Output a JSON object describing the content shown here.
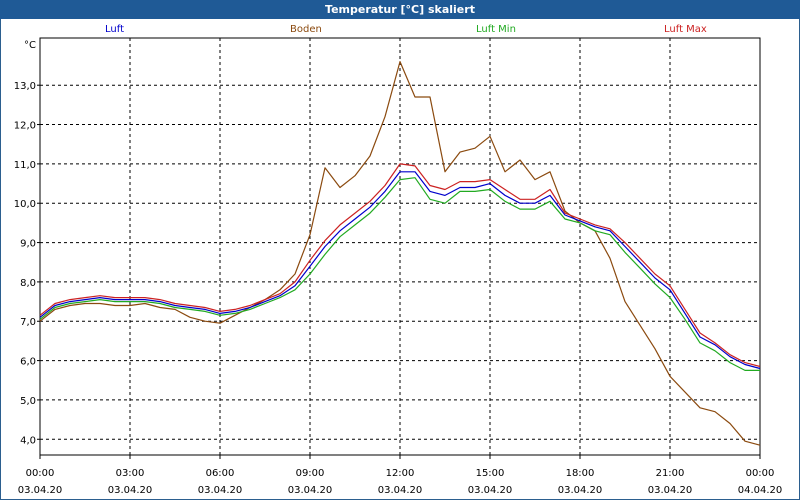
{
  "chart_data": {
    "type": "line",
    "title": "Temperatur [°C] skaliert",
    "y_unit": "°C",
    "ylim": [
      3.6,
      14.2
    ],
    "yticks": [
      "13,0",
      "12,0",
      "11,0",
      "10,0",
      "9,0",
      "8,0",
      "7,0",
      "6,0",
      "5,0",
      "4,0"
    ],
    "ytick_values": [
      13,
      12,
      11,
      10,
      9,
      8,
      7,
      6,
      5,
      4
    ],
    "x_ticks": [
      {
        "time": "00:00",
        "date": "03.04.20"
      },
      {
        "time": "03:00",
        "date": "03.04.20"
      },
      {
        "time": "06:00",
        "date": "03.04.20"
      },
      {
        "time": "09:00",
        "date": "03.04.20"
      },
      {
        "time": "12:00",
        "date": "03.04.20"
      },
      {
        "time": "15:00",
        "date": "03.04.20"
      },
      {
        "time": "18:00",
        "date": "03.04.20"
      },
      {
        "time": "21:00",
        "date": "03.04.20"
      },
      {
        "time": "00:00",
        "date": "04.04.20"
      }
    ],
    "x_hours_range": [
      0,
      24
    ],
    "grid": true,
    "legend_position": "top",
    "series": [
      {
        "name": "Luft",
        "color": "#0000cc",
        "x": [
          0,
          0.5,
          1,
          1.5,
          2,
          2.5,
          3,
          3.5,
          4,
          4.5,
          5,
          5.5,
          6,
          6.5,
          7,
          7.5,
          8,
          8.5,
          9,
          9.5,
          10,
          10.5,
          11,
          11.5,
          12,
          12.5,
          13,
          13.5,
          14,
          14.5,
          15,
          15.5,
          16,
          16.5,
          17,
          17.5,
          18,
          18.5,
          19,
          19.5,
          20,
          20.5,
          21,
          21.5,
          22,
          22.5,
          23,
          23.5,
          24
        ],
        "values": [
          7.1,
          7.4,
          7.5,
          7.55,
          7.6,
          7.55,
          7.55,
          7.55,
          7.5,
          7.4,
          7.35,
          7.3,
          7.2,
          7.25,
          7.35,
          7.5,
          7.65,
          7.9,
          8.4,
          8.9,
          9.3,
          9.6,
          9.9,
          10.3,
          10.8,
          10.8,
          10.3,
          10.2,
          10.4,
          10.4,
          10.5,
          10.2,
          10.0,
          10.0,
          10.2,
          9.7,
          9.55,
          9.4,
          9.3,
          8.9,
          8.5,
          8.1,
          7.8,
          7.2,
          6.6,
          6.4,
          6.1,
          5.9,
          5.8
        ]
      },
      {
        "name": "Boden",
        "color": "#8b4a0f",
        "x": [
          0,
          0.5,
          1,
          1.5,
          2,
          2.5,
          3,
          3.5,
          4,
          4.5,
          5,
          5.5,
          6,
          6.5,
          7,
          7.5,
          8,
          8.5,
          9,
          9.5,
          10,
          10.5,
          11,
          11.5,
          12,
          12.5,
          13,
          13.5,
          14,
          14.5,
          15,
          15.5,
          16,
          16.5,
          17,
          17.5,
          18,
          18.5,
          19,
          19.5,
          20,
          20.5,
          21,
          21.5,
          22,
          22.5,
          23,
          23.5,
          24
        ],
        "values": [
          7.0,
          7.3,
          7.4,
          7.45,
          7.45,
          7.4,
          7.4,
          7.45,
          7.35,
          7.3,
          7.1,
          7.0,
          6.95,
          7.15,
          7.35,
          7.55,
          7.8,
          8.2,
          9.2,
          10.9,
          10.4,
          10.7,
          11.2,
          12.2,
          13.6,
          12.7,
          12.7,
          10.8,
          11.3,
          11.4,
          11.7,
          10.8,
          11.1,
          10.6,
          10.8,
          9.8,
          9.5,
          9.3,
          8.6,
          7.5,
          6.9,
          6.3,
          5.6,
          5.2,
          4.8,
          4.7,
          4.4,
          3.95,
          3.85
        ]
      },
      {
        "name": "Luft Min",
        "color": "#22aa22",
        "x": [
          0,
          0.5,
          1,
          1.5,
          2,
          2.5,
          3,
          3.5,
          4,
          4.5,
          5,
          5.5,
          6,
          6.5,
          7,
          7.5,
          8,
          8.5,
          9,
          9.5,
          10,
          10.5,
          11,
          11.5,
          12,
          12.5,
          13,
          13.5,
          14,
          14.5,
          15,
          15.5,
          16,
          16.5,
          17,
          17.5,
          18,
          18.5,
          19,
          19.5,
          20,
          20.5,
          21,
          21.5,
          22,
          22.5,
          23,
          23.5,
          24
        ],
        "values": [
          7.05,
          7.35,
          7.45,
          7.5,
          7.55,
          7.5,
          7.5,
          7.5,
          7.45,
          7.35,
          7.3,
          7.25,
          7.15,
          7.2,
          7.3,
          7.45,
          7.6,
          7.8,
          8.2,
          8.7,
          9.15,
          9.45,
          9.75,
          10.15,
          10.6,
          10.65,
          10.1,
          10.0,
          10.3,
          10.3,
          10.35,
          10.05,
          9.85,
          9.85,
          10.05,
          9.6,
          9.5,
          9.3,
          9.2,
          8.75,
          8.35,
          7.95,
          7.6,
          7.05,
          6.45,
          6.25,
          5.95,
          5.75,
          5.75
        ]
      },
      {
        "name": "Luft Max",
        "color": "#cc2222",
        "x": [
          0,
          0.5,
          1,
          1.5,
          2,
          2.5,
          3,
          3.5,
          4,
          4.5,
          5,
          5.5,
          6,
          6.5,
          7,
          7.5,
          8,
          8.5,
          9,
          9.5,
          10,
          10.5,
          11,
          11.5,
          12,
          12.5,
          13,
          13.5,
          14,
          14.5,
          15,
          15.5,
          16,
          16.5,
          17,
          17.5,
          18,
          18.5,
          19,
          19.5,
          20,
          20.5,
          21,
          21.5,
          22,
          22.5,
          23,
          23.5,
          24
        ],
        "values": [
          7.15,
          7.45,
          7.55,
          7.6,
          7.65,
          7.6,
          7.6,
          7.6,
          7.55,
          7.45,
          7.4,
          7.35,
          7.25,
          7.3,
          7.4,
          7.55,
          7.7,
          8.0,
          8.55,
          9.05,
          9.45,
          9.75,
          10.05,
          10.45,
          11.0,
          10.95,
          10.45,
          10.35,
          10.55,
          10.55,
          10.6,
          10.35,
          10.1,
          10.1,
          10.35,
          9.75,
          9.6,
          9.45,
          9.35,
          9.0,
          8.6,
          8.2,
          7.9,
          7.3,
          6.7,
          6.45,
          6.15,
          5.95,
          5.85
        ]
      }
    ]
  }
}
